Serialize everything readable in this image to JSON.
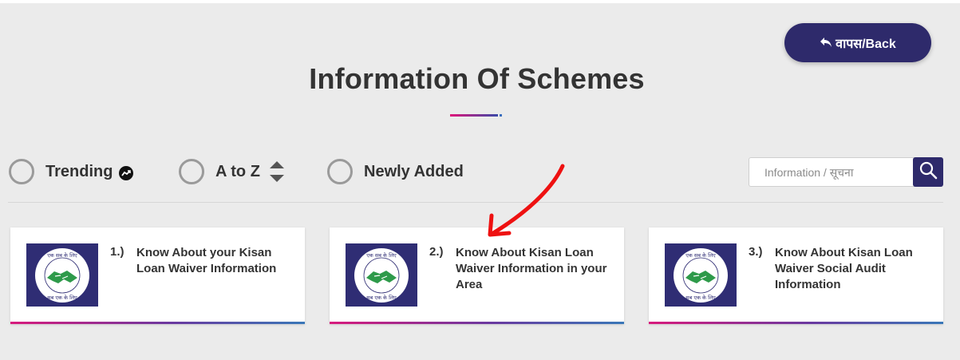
{
  "header": {
    "back_label": "वापस/Back",
    "title": "Information Of Schemes"
  },
  "filters": [
    {
      "label": "Trending",
      "icon": "trending-icon"
    },
    {
      "label": "A to Z",
      "icon": "sort-icon"
    },
    {
      "label": "Newly Added"
    }
  ],
  "search": {
    "placeholder": "Information / सूचना",
    "value": "",
    "icon": "search-icon"
  },
  "cards": [
    {
      "number": "1.)",
      "title": "Know About your Kisan Loan Waiver Information",
      "logo_top": "एक सब के लिए",
      "logo_bottom": "सब एक के लिए"
    },
    {
      "number": "2.)",
      "title": "Know About Kisan Loan Waiver Information in your Area",
      "logo_top": "एक सब के लिए",
      "logo_bottom": "सब एक के लिए"
    },
    {
      "number": "3.)",
      "title": "Know About Kisan Loan Waiver Social Audit Information",
      "logo_top": "एक सब के लिए",
      "logo_bottom": "सब एक के लिए"
    }
  ],
  "colors": {
    "primary": "#2e2a6b",
    "background": "#ebebeb",
    "gradient_start": "#d81b7d",
    "gradient_end": "#3a78b8",
    "annotation": "#ee1111"
  }
}
